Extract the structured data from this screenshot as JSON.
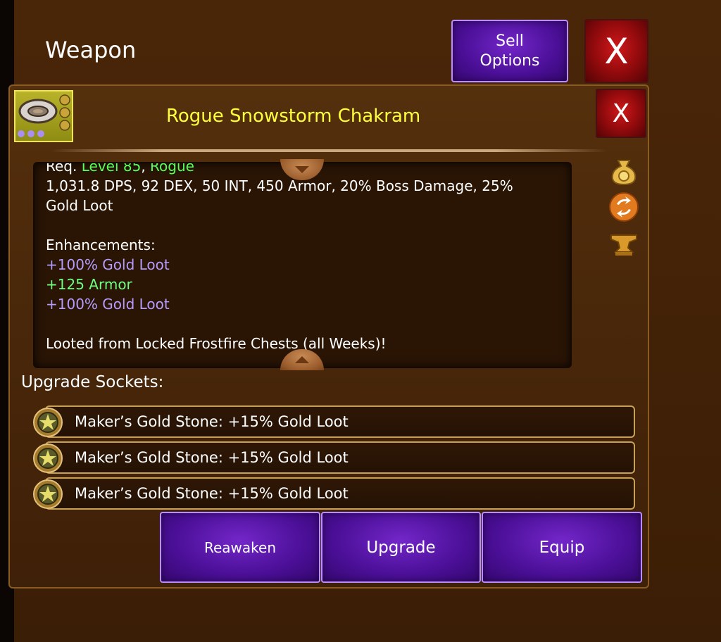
{
  "header": {
    "title": "Weapon",
    "sell_options_label": "Sell Options",
    "close_label": "X"
  },
  "item": {
    "name": "Rogue Snowstorm Chakram",
    "close_label": "X",
    "icon": "chakram-icon",
    "side_icons": [
      "gold-bag-icon",
      "refresh-swap-icon",
      "anvil-icon"
    ],
    "description": {
      "req_prefix": "Req.",
      "req_level": "Level 85",
      "req_class": "Rogue",
      "stats_line1": "1,031.8 DPS, 92 DEX, 50 INT, 450 Armor, 20% Boss Damage, 25%",
      "stats_line2": "Gold Loot",
      "enhancements_title": "Enhancements:",
      "enhancements": [
        "+100% Gold Loot",
        "+125 Armor",
        "+100% Gold Loot"
      ],
      "source": "Looted from Locked Frostfire Chests (all Weeks)!"
    }
  },
  "sockets": {
    "title": "Upgrade Sockets:",
    "items": [
      "Maker’s Gold Stone: +15% Gold Loot",
      "Maker’s Gold Stone: +15% Gold Loot",
      "Maker’s Gold Stone: +15% Gold Loot"
    ]
  },
  "actions": {
    "reawaken": "Reawaken",
    "upgrade": "Upgrade",
    "equip": "Equip"
  },
  "colors": {
    "background": "#3a1d07",
    "button_purple": "#4a0f96",
    "close_red": "#c0181b",
    "item_name_yellow": "#ffff3a",
    "requirement_green": "#59ff59",
    "enhancement_lavender": "#b49cff",
    "enhancement_green": "#6fff80"
  }
}
